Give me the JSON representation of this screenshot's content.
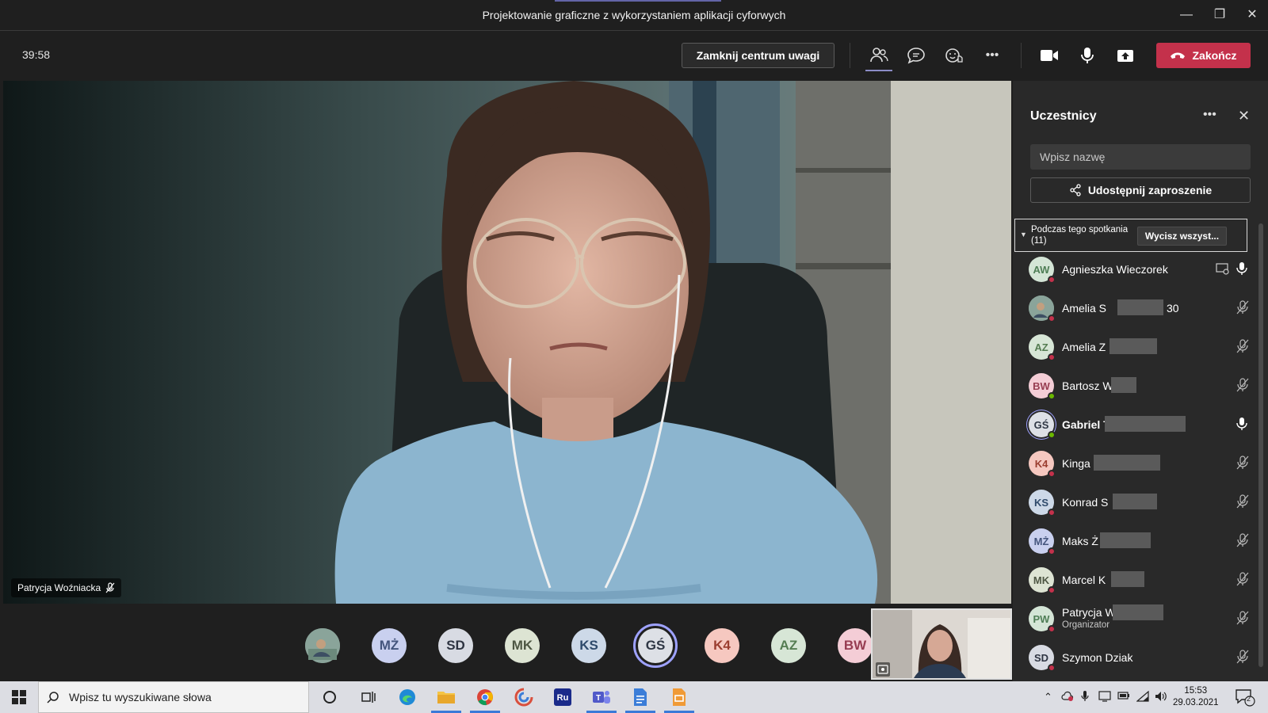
{
  "window": {
    "title": "Projektowanie graficzne z wykorzystaniem aplikacji cyforwych"
  },
  "toolbar": {
    "timer": "39:58",
    "spotlight_label": "Zamknij centrum uwagi",
    "end_label": "Zakończ",
    "more_label": "•••"
  },
  "stage": {
    "speaker_name": "Patrycja Woźniacka"
  },
  "strip": {
    "avatars": [
      {
        "initials": "",
        "bg": "#8aa49a",
        "color": "#fff"
      },
      {
        "initials": "MŻ",
        "bg": "#c9d0ef",
        "color": "#44557d"
      },
      {
        "initials": "SD",
        "bg": "#d8dbe3",
        "color": "#2e3442"
      },
      {
        "initials": "MK",
        "bg": "#dde4d3",
        "color": "#4e5744"
      },
      {
        "initials": "KS",
        "bg": "#cdd9e8",
        "color": "#2f4a6b"
      },
      {
        "initials": "GŚ",
        "bg": "#dde0e6",
        "color": "#2f3745"
      },
      {
        "initials": "K4",
        "bg": "#f6c8c0",
        "color": "#9b3e30"
      },
      {
        "initials": "AZ",
        "bg": "#d7e6d6",
        "color": "#557d52"
      },
      {
        "initials": "BW",
        "bg": "#f4cdd6",
        "color": "#973d52"
      }
    ]
  },
  "panel": {
    "title": "Uczestnicy",
    "more_label": "•••",
    "close_label": "✕",
    "search_placeholder": "Wpisz nazwę",
    "invite_label": "Udostępnij zaproszenie",
    "section_label": "Podczas tego spotkania (11)",
    "mute_all_label": "Wycisz wszyst...",
    "participants": [
      {
        "initials": "AW",
        "name": "Agnieszka Wieczorek",
        "bg": "#d4e5d6",
        "color": "#4f7e56",
        "status": "#c4314b",
        "mic": "on",
        "role": ""
      },
      {
        "initials": "",
        "name": "Amelia S",
        "suffix": "30",
        "bg": "#8aa49a",
        "color": "#fff",
        "status": "#c4314b",
        "mic": "off",
        "role": ""
      },
      {
        "initials": "AZ",
        "name": "Amelia Z",
        "bg": "#d7e6d6",
        "color": "#557d52",
        "status": "#c4314b",
        "mic": "off",
        "role": ""
      },
      {
        "initials": "BW",
        "name": "Bartosz W",
        "bg": "#f4cdd6",
        "color": "#973d52",
        "status": "#6bb700",
        "mic": "off",
        "role": ""
      },
      {
        "initials": "GŚ",
        "name": "Gabriel T",
        "bg": "#dde0e6",
        "color": "#2f3745",
        "status": "#6bb700",
        "mic": "on",
        "role": ""
      },
      {
        "initials": "K4",
        "name": "Kinga",
        "bg": "#f6c8c0",
        "color": "#9b3e30",
        "status": "#c4314b",
        "mic": "off",
        "role": ""
      },
      {
        "initials": "KS",
        "name": "Konrad S",
        "bg": "#cdd9e8",
        "color": "#2f4a6b",
        "status": "#c4314b",
        "mic": "off",
        "role": ""
      },
      {
        "initials": "MŻ",
        "name": "Maks Ż",
        "bg": "#c9d0ef",
        "color": "#44557d",
        "status": "#c4314b",
        "mic": "off",
        "role": ""
      },
      {
        "initials": "MK",
        "name": "Marcel K",
        "bg": "#dde4d3",
        "color": "#4e5744",
        "status": "#c4314b",
        "mic": "off",
        "role": ""
      },
      {
        "initials": "PW",
        "name": "Patrycja W",
        "bg": "#d4e5d6",
        "color": "#4f7e56",
        "status": "#c4314b",
        "mic": "off",
        "role": "Organizator"
      },
      {
        "initials": "SD",
        "name": "Szymon Dziak",
        "bg": "#d8dbe3",
        "color": "#2e3442",
        "status": "#c4314b",
        "mic": "off",
        "role": ""
      }
    ]
  },
  "taskbar": {
    "search_placeholder": "Wpisz tu wyszukiwane słowa",
    "time": "15:53",
    "date": "29.03.2021",
    "notification_count": "2"
  }
}
